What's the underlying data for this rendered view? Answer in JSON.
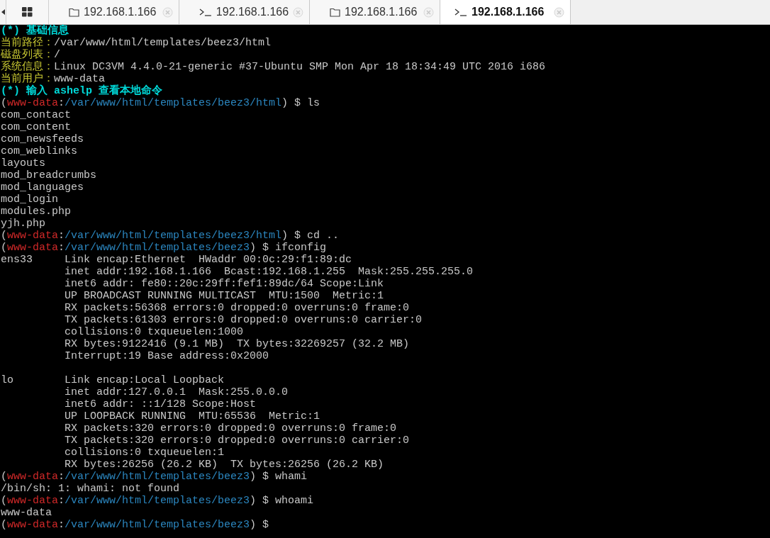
{
  "tabs": [
    {
      "kind": "folder",
      "label": "192.168.1.166",
      "selected": false
    },
    {
      "kind": "terminal",
      "label": "192.168.1.166",
      "selected": false
    },
    {
      "kind": "folder",
      "label": "192.168.1.166",
      "selected": false
    },
    {
      "kind": "terminal",
      "label": "192.168.1.166",
      "selected": true
    }
  ],
  "terminal": {
    "blocks": [
      {
        "lines": [
          {
            "segments": [
              {
                "kind": "heading",
                "text": "(*) 基础信息"
              }
            ]
          },
          {
            "segments": [
              {
                "kind": "label",
                "text": "当前路径："
              },
              {
                "kind": "plain",
                "text": "/var/www/html/templates/beez3/html"
              }
            ]
          },
          {
            "segments": [
              {
                "kind": "label",
                "text": "磁盘列表："
              },
              {
                "kind": "plain",
                "text": "/"
              }
            ]
          },
          {
            "segments": [
              {
                "kind": "label",
                "text": "系统信息："
              },
              {
                "kind": "plain",
                "text": "Linux DC3VM 4.4.0-21-generic #37-Ubuntu SMP Mon Apr 18 18:34:49 UTC 2016 i686"
              }
            ]
          },
          {
            "segments": [
              {
                "kind": "label",
                "text": "当前用户："
              },
              {
                "kind": "plain",
                "text": "www-data"
              }
            ]
          },
          {
            "segments": [
              {
                "kind": "heading",
                "text": "(*) 输入 ashelp 查看本地命令"
              }
            ]
          },
          {
            "segments": [
              {
                "kind": "plain",
                "text": "("
              },
              {
                "kind": "user",
                "text": "www-data"
              },
              {
                "kind": "plain",
                "text": ":"
              },
              {
                "kind": "path",
                "text": "/var/www/html/templates/beez3/html"
              },
              {
                "kind": "plain",
                "text": ") $ ls"
              }
            ]
          },
          {
            "segments": [
              {
                "kind": "plain",
                "text": "com_contact"
              }
            ]
          },
          {
            "segments": [
              {
                "kind": "plain",
                "text": "com_content"
              }
            ]
          },
          {
            "segments": [
              {
                "kind": "plain",
                "text": "com_newsfeeds"
              }
            ]
          },
          {
            "segments": [
              {
                "kind": "plain",
                "text": "com_weblinks"
              }
            ]
          },
          {
            "segments": [
              {
                "kind": "plain",
                "text": "layouts"
              }
            ]
          },
          {
            "segments": [
              {
                "kind": "plain",
                "text": "mod_breadcrumbs"
              }
            ]
          },
          {
            "segments": [
              {
                "kind": "plain",
                "text": "mod_languages"
              }
            ]
          },
          {
            "segments": [
              {
                "kind": "plain",
                "text": "mod_login"
              }
            ]
          },
          {
            "segments": [
              {
                "kind": "plain",
                "text": "modules.php"
              }
            ]
          },
          {
            "segments": [
              {
                "kind": "plain",
                "text": "yjh.php"
              }
            ]
          },
          {
            "segments": [
              {
                "kind": "plain",
                "text": "("
              },
              {
                "kind": "user",
                "text": "www-data"
              },
              {
                "kind": "plain",
                "text": ":"
              },
              {
                "kind": "path",
                "text": "/var/www/html/templates/beez3/html"
              },
              {
                "kind": "plain",
                "text": ") $ cd .."
              }
            ]
          },
          {
            "segments": [
              {
                "kind": "plain",
                "text": "("
              },
              {
                "kind": "user",
                "text": "www-data"
              },
              {
                "kind": "plain",
                "text": ":"
              },
              {
                "kind": "path",
                "text": "/var/www/html/templates/beez3"
              },
              {
                "kind": "plain",
                "text": ") $ ifconfig"
              }
            ]
          },
          {
            "segments": [
              {
                "kind": "plain",
                "text": "ens33     Link encap:Ethernet  HWaddr 00:0c:29:f1:89:dc"
              }
            ]
          },
          {
            "segments": [
              {
                "kind": "plain",
                "text": "          inet addr:192.168.1.166  Bcast:192.168.1.255  Mask:255.255.255.0"
              }
            ]
          },
          {
            "segments": [
              {
                "kind": "plain",
                "text": "          inet6 addr: fe80::20c:29ff:fef1:89dc/64 Scope:Link"
              }
            ]
          },
          {
            "segments": [
              {
                "kind": "plain",
                "text": "          UP BROADCAST RUNNING MULTICAST  MTU:1500  Metric:1"
              }
            ]
          },
          {
            "segments": [
              {
                "kind": "plain",
                "text": "          RX packets:56368 errors:0 dropped:0 overruns:0 frame:0"
              }
            ]
          },
          {
            "segments": [
              {
                "kind": "plain",
                "text": "          TX packets:61303 errors:0 dropped:0 overruns:0 carrier:0"
              }
            ]
          },
          {
            "segments": [
              {
                "kind": "plain",
                "text": "          collisions:0 txqueuelen:1000"
              }
            ]
          },
          {
            "segments": [
              {
                "kind": "plain",
                "text": "          RX bytes:9122416 (9.1 MB)  TX bytes:32269257 (32.2 MB)"
              }
            ]
          },
          {
            "segments": [
              {
                "kind": "plain",
                "text": "          Interrupt:19 Base address:0x2000"
              }
            ]
          }
        ]
      },
      {
        "lines": [
          {
            "segments": [
              {
                "kind": "plain",
                "text": "lo        Link encap:Local Loopback"
              }
            ]
          },
          {
            "segments": [
              {
                "kind": "plain",
                "text": "          inet addr:127.0.0.1  Mask:255.0.0.0"
              }
            ]
          },
          {
            "segments": [
              {
                "kind": "plain",
                "text": "          inet6 addr: ::1/128 Scope:Host"
              }
            ]
          },
          {
            "segments": [
              {
                "kind": "plain",
                "text": "          UP LOOPBACK RUNNING  MTU:65536  Metric:1"
              }
            ]
          },
          {
            "segments": [
              {
                "kind": "plain",
                "text": "          RX packets:320 errors:0 dropped:0 overruns:0 frame:0"
              }
            ]
          },
          {
            "segments": [
              {
                "kind": "plain",
                "text": "          TX packets:320 errors:0 dropped:0 overruns:0 carrier:0"
              }
            ]
          },
          {
            "segments": [
              {
                "kind": "plain",
                "text": "          collisions:0 txqueuelen:1"
              }
            ]
          },
          {
            "segments": [
              {
                "kind": "plain",
                "text": "          RX bytes:26256 (26.2 KB)  TX bytes:26256 (26.2 KB)"
              }
            ]
          },
          {
            "segments": [
              {
                "kind": "plain",
                "text": "("
              },
              {
                "kind": "user",
                "text": "www-data"
              },
              {
                "kind": "plain",
                "text": ":"
              },
              {
                "kind": "path",
                "text": "/var/www/html/templates/beez3"
              },
              {
                "kind": "plain",
                "text": ") $ whami"
              }
            ]
          },
          {
            "segments": [
              {
                "kind": "plain",
                "text": "/bin/sh: 1: whami: not found"
              }
            ]
          },
          {
            "segments": [
              {
                "kind": "plain",
                "text": "("
              },
              {
                "kind": "user",
                "text": "www-data"
              },
              {
                "kind": "plain",
                "text": ":"
              },
              {
                "kind": "path",
                "text": "/var/www/html/templates/beez3"
              },
              {
                "kind": "plain",
                "text": ") $ whoami"
              }
            ]
          },
          {
            "segments": [
              {
                "kind": "plain",
                "text": "www-data"
              }
            ]
          },
          {
            "segments": [
              {
                "kind": "plain",
                "text": "("
              },
              {
                "kind": "user",
                "text": "www-data"
              },
              {
                "kind": "plain",
                "text": ":"
              },
              {
                "kind": "path",
                "text": "/var/www/html/templates/beez3"
              },
              {
                "kind": "plain",
                "text": ") $"
              }
            ]
          }
        ]
      }
    ]
  }
}
